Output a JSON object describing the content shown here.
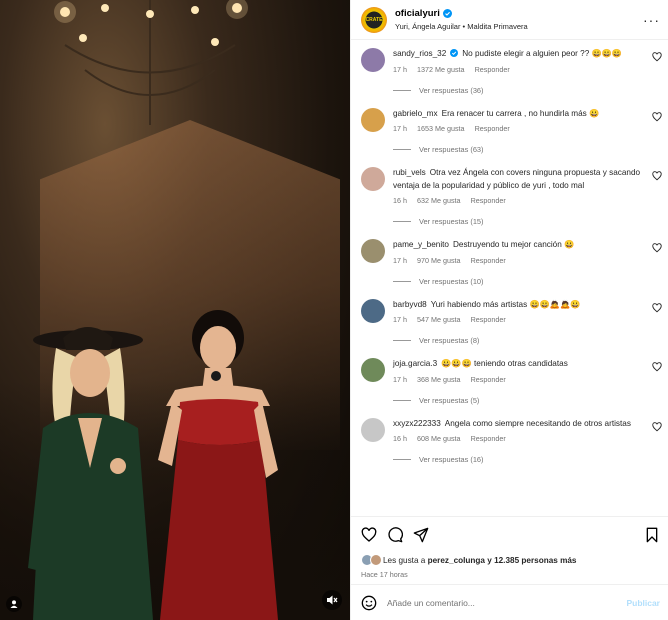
{
  "post": {
    "username": "oficialyuri",
    "avatar_text": "CRATE",
    "subtitle": "Yuri, Ángela Aguilar • Maldita Primavera",
    "more_icon": "more-horizontal-icon"
  },
  "comments": [
    {
      "user": "sandy_rios_32",
      "verified": true,
      "text": "No pudiste elegir a alguien peor ?? 😀😀😀",
      "time": "17 h",
      "likes": "1372 Me gusta",
      "reply": "Responder",
      "replies": "Ver respuestas (36)",
      "avatar_color": "#8d7aa8"
    },
    {
      "user": "gabrielo_mx",
      "verified": false,
      "text": "Era renacer tu carrera , no hundirla más 😀",
      "time": "17 h",
      "likes": "1653 Me gusta",
      "reply": "Responder",
      "replies": "Ver respuestas (63)",
      "avatar_color": "#d7a04b"
    },
    {
      "user": "rubi_vels",
      "verified": false,
      "text": "Otra vez Ángela con covers ninguna propuesta y sacando ventaja de la popularidad y público de yuri , todo mal",
      "time": "16 h",
      "likes": "632 Me gusta",
      "reply": "Responder",
      "replies": "Ver respuestas (15)",
      "avatar_color": "#cfa99a"
    },
    {
      "user": "pame_y_benito",
      "verified": false,
      "text": "Destruyendo tu mejor canción 😀",
      "time": "17 h",
      "likes": "970 Me gusta",
      "reply": "Responder",
      "replies": "Ver respuestas (10)",
      "avatar_color": "#9a8f6e"
    },
    {
      "user": "barbyvd8",
      "verified": false,
      "text": "Yuri habiendo más artistas 😀😀🙇🙇😀",
      "time": "17 h",
      "likes": "547 Me gusta",
      "reply": "Responder",
      "replies": "Ver respuestas (8)",
      "avatar_color": "#4d6a86"
    },
    {
      "user": "joja.garcia.3",
      "verified": false,
      "text": "😀😀😀 teniendo otras candidatas",
      "time": "17 h",
      "likes": "368 Me gusta",
      "reply": "Responder",
      "replies": "Ver respuestas (5)",
      "avatar_color": "#6f8a5a"
    },
    {
      "user": "xxyzx222333",
      "verified": false,
      "text": "Angela como siempre necesitando de otros artistas",
      "time": "16 h",
      "likes": "608 Me gusta",
      "reply": "Responder",
      "replies": "Ver respuestas (16)",
      "avatar_color": "#c7c7c7"
    }
  ],
  "actions": {
    "like_icon": "heart-icon",
    "comment_icon": "comment-icon",
    "share_icon": "send-icon",
    "save_icon": "bookmark-icon"
  },
  "likes": {
    "prefix": "Les gusta a",
    "user": "perez_colunga",
    "suffix": "y 12.385 personas más"
  },
  "time_ago": "Hace 17 horas",
  "composer": {
    "placeholder": "Añade un comentario...",
    "publish": "Publicar"
  }
}
